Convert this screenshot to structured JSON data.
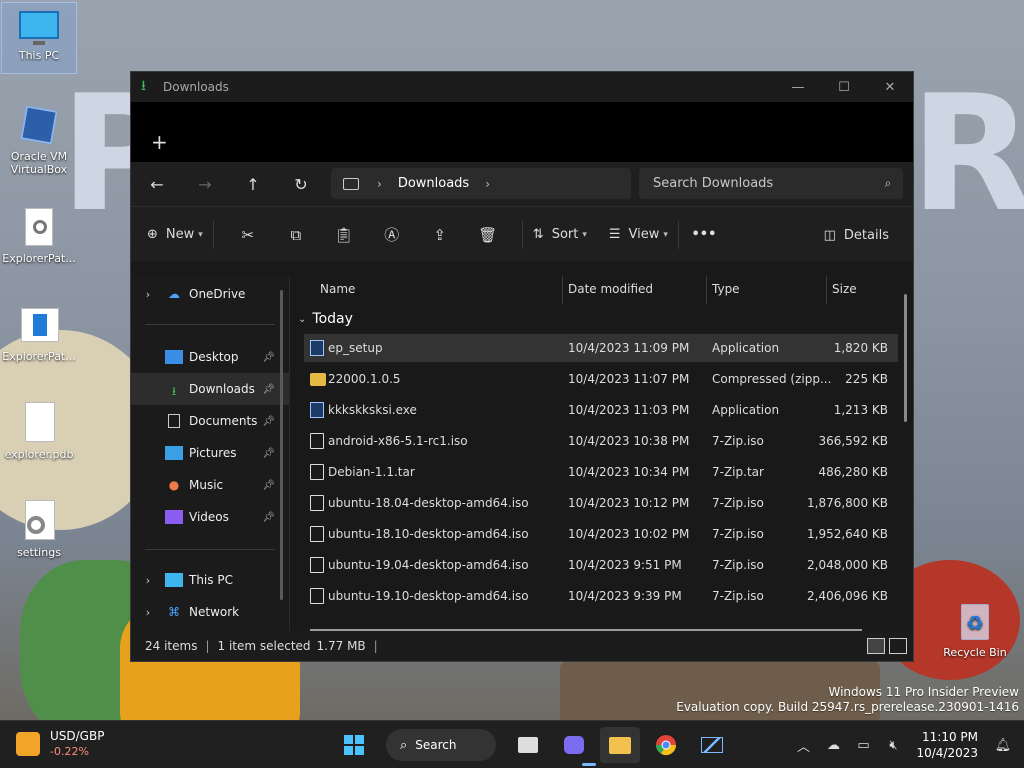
{
  "desktop": {
    "icons": [
      {
        "label": "This PC"
      },
      {
        "label": "Oracle VM VirtualBox"
      },
      {
        "label": "ExplorerPat..."
      },
      {
        "label": "ExplorerPat..."
      },
      {
        "label": "explorer.pdb"
      },
      {
        "label": "settings"
      },
      {
        "label": "Recycle Bin"
      }
    ],
    "watermark_line1": "Windows 11 Pro Insider Preview",
    "watermark_line2": "Evaluation copy. Build 25947.rs_prerelease.230901-1416"
  },
  "window": {
    "title": "Downloads",
    "new_tab": "+",
    "address": {
      "crumb": "Downloads"
    },
    "search_placeholder": "Search Downloads",
    "toolbar": {
      "new_label": "New",
      "sort_label": "Sort",
      "view_label": "View",
      "more_label": "•••",
      "details_label": "Details"
    },
    "sidebar": [
      {
        "label": "OneDrive"
      },
      {
        "label": "Desktop"
      },
      {
        "label": "Downloads"
      },
      {
        "label": "Documents"
      },
      {
        "label": "Pictures"
      },
      {
        "label": "Music"
      },
      {
        "label": "Videos"
      },
      {
        "label": "This PC"
      },
      {
        "label": "Network"
      }
    ],
    "columns": {
      "name": "Name",
      "date": "Date modified",
      "type": "Type",
      "size": "Size"
    },
    "group_label": "Today",
    "files": [
      {
        "name": "ep_setup",
        "date": "10/4/2023 11:09 PM",
        "type": "Application",
        "size": "1,820 KB"
      },
      {
        "name": "22000.1.0.5",
        "date": "10/4/2023 11:07 PM",
        "type": "Compressed (zipp...",
        "size": "225 KB"
      },
      {
        "name": "kkkskksksi.exe",
        "date": "10/4/2023 11:03 PM",
        "type": "Application",
        "size": "1,213 KB"
      },
      {
        "name": "android-x86-5.1-rc1.iso",
        "date": "10/4/2023 10:38 PM",
        "type": "7-Zip.iso",
        "size": "366,592 KB"
      },
      {
        "name": "Debian-1.1.tar",
        "date": "10/4/2023 10:34 PM",
        "type": "7-Zip.tar",
        "size": "486,280 KB"
      },
      {
        "name": "ubuntu-18.04-desktop-amd64.iso",
        "date": "10/4/2023 10:12 PM",
        "type": "7-Zip.iso",
        "size": "1,876,800 KB"
      },
      {
        "name": "ubuntu-18.10-desktop-amd64.iso",
        "date": "10/4/2023 10:02 PM",
        "type": "7-Zip.iso",
        "size": "1,952,640 KB"
      },
      {
        "name": "ubuntu-19.04-desktop-amd64.iso",
        "date": "10/4/2023 9:51 PM",
        "type": "7-Zip.iso",
        "size": "2,048,000 KB"
      },
      {
        "name": "ubuntu-19.10-desktop-amd64.iso",
        "date": "10/4/2023 9:39 PM",
        "type": "7-Zip.iso",
        "size": "2,406,096 KB"
      }
    ],
    "status": {
      "items": "24 items",
      "selected": "1 item selected",
      "size": "1.77 MB",
      "bar": "|"
    }
  },
  "taskbar": {
    "widget_title": "USD/GBP",
    "widget_value": "-0.22%",
    "search_label": "Search",
    "time": "11:10 PM",
    "date": "10/4/2023"
  },
  "colors": {
    "accent": "#7ab8ff",
    "window_bg": "#191919",
    "selection": "#333333"
  }
}
